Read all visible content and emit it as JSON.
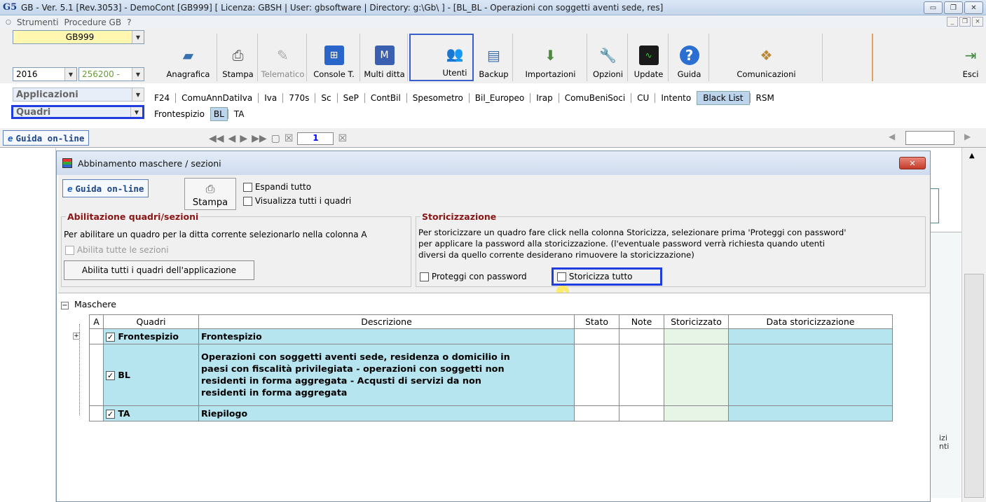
{
  "window": {
    "title": "GB - Ver. 5.1 [Rev.3053] - DemoCont [GB999]    [ Licenza: GBSH | User: gbsoftware | Directory: g:\\Gb\\ ] - [BL_BL - Operazioni con soggetti aventi sede, res]",
    "app_icon": "G5"
  },
  "menu": {
    "items": [
      "Strumenti",
      "Procedure GB",
      "?"
    ]
  },
  "toolbar": {
    "company_code": "GB999",
    "year": "2016",
    "code2": "256200 -",
    "buttons": [
      "Anagrafica",
      "Stampa",
      "Telematico",
      "Console T.",
      "Multi ditta",
      "Utenti",
      "Backup",
      "Importazioni",
      "Opzioni",
      "Update",
      "Guida",
      "Comunicazioni",
      "Esci"
    ],
    "applicazioni_label": "Applicazioni",
    "quadri_label": "Quadri",
    "app_tabs": [
      "F24",
      "ComuAnnDatiIva",
      "Iva",
      "770s",
      "Sc",
      "SeP",
      "ContBil",
      "Spesometro",
      "Bil_Europeo",
      "Irap",
      "ComuBeniSoci",
      "CU",
      "Intento",
      "Black List",
      "RSM"
    ],
    "active_app_tab": "Black List",
    "quadri_tabs": [
      "Frontespizio",
      "BL",
      "TA"
    ]
  },
  "nav": {
    "guida": "Guida on-line",
    "page": "1"
  },
  "dialog": {
    "title": "Abbinamento maschere / sezioni",
    "guida": "Guida on-line",
    "stampa": "Stampa",
    "espandi": "Espandi tutto",
    "visualizza": "Visualizza tutti i quadri",
    "abil_legend": "Abilitazione quadri/sezioni",
    "abil_text": "Per abilitare un quadro per la ditta corrente selezionarlo nella colonna A",
    "abil_all_sections": "Abilita tutte le sezioni",
    "abil_btn": "Abilita tutti i quadri dell'applicazione",
    "stor_legend": "Storicizzazione",
    "stor_text1": "Per storicizzare un quadro fare click nella colonna Storicizza, selezionare prima 'Proteggi con password'",
    "stor_text2": "per applicare la password alla storicizzazione. (l'eventuale password verrà richiesta quando utenti",
    "stor_text3": "diversi da quello corrente desiderano rimuovere la storicizzazione)",
    "proteggi": "Proteggi con password",
    "storicizza": "Storicizza tutto",
    "tree_root": "Maschere",
    "columns": [
      "A",
      "Quadri",
      "Descrizione",
      "Stato",
      "Note",
      "Storicizzato",
      "Data storicizzazione"
    ],
    "rows": [
      {
        "quadro": "Frontespizio",
        "desc": "Frontespizio"
      },
      {
        "quadro": "BL",
        "desc1": "Operazioni con soggetti aventi sede, residenza o domicilio in",
        "desc2": "paesi con fiscalità privilegiata - operazioni con soggetti non",
        "desc3": "residenti in forma aggregata - Acqusti di servizi da non",
        "desc4": "residenti in forma aggregata"
      },
      {
        "quadro": "TA",
        "desc": "Riepilogo"
      }
    ]
  },
  "side": {
    "t1": "izi",
    "t2": "nti"
  }
}
